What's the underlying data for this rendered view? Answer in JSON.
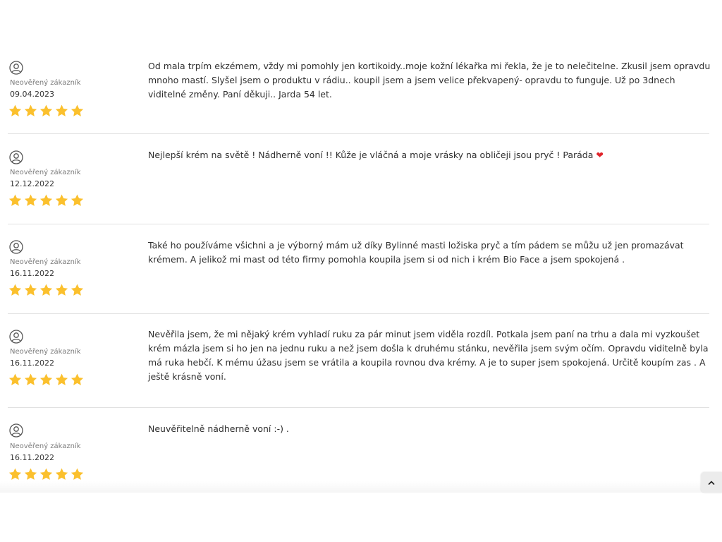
{
  "colors": {
    "star": "#fbc02d",
    "divider": "#e1e1e1",
    "heart": "#e0242b"
  },
  "reviews": [
    {
      "author": "Neověřený zákazník",
      "date": "09.04.2023",
      "rating": 5,
      "text": "Od mala trpím ekzémem, vždy mi pomohly jen kortikoidy..moje kožní lékařka mi řekla, že je to nelečitelne. Zkusil jsem opravdu mnoho mastí. Slyšel jsem o produktu v rádiu.. koupil jsem a jsem velice překvapený- opravdu to funguje. Už po 3dnech viditelné změny. Paní děkuji.. Jarda 54 let."
    },
    {
      "author": "Neověřený zákazník",
      "date": "12.12.2022",
      "rating": 5,
      "text": "Nejlepší krém na světě ! Nádherně voní !! Kůže je vláčná a moje vrásky na obličeji jsou pryč ! Paráda",
      "emoji": "❤"
    },
    {
      "author": "Neověřený zákazník",
      "date": "16.11.2022",
      "rating": 5,
      "text": "Také ho používáme všichni a je výborný mám už díky Bylinné masti ložiska pryč a tím pádem se můžu už jen promazávat krémem. A jelikož mi mast od této firmy pomohla koupila jsem si od nich i krém Bio Face a jsem spokojená ."
    },
    {
      "author": "Neověřený zákazník",
      "date": "16.11.2022",
      "rating": 5,
      "text": "Nevěřila jsem, že mi nějaký krém vyhladí ruku za pár minut jsem viděla rozdíl. Potkala jsem paní na trhu a dala mi vyzkoušet krém mázla jsem si ho jen na jednu ruku a než jsem došla k druhému stánku, nevěřila jsem svým očím. Opravdu viditelně byla má ruka hebčí. K mému úžasu jsem se vrátila a koupila rovnou dva krémy. A je to super jsem spokojená. Určitě koupím zas . A ještě krásně voní."
    },
    {
      "author": "Neověřený zákazník",
      "date": "16.11.2022",
      "rating": 5,
      "text": "Neuvěřitelně nádherně voní :-) ."
    }
  ],
  "scroll_top": {
    "icon": "chevron-up-icon"
  }
}
